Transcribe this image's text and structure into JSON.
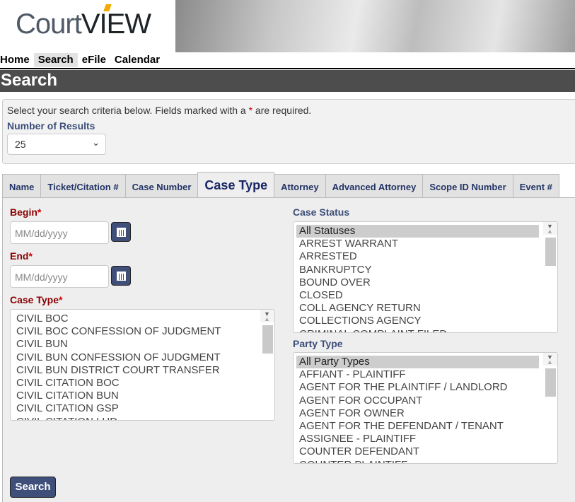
{
  "logo": {
    "text_a": "Court",
    "text_b": "VIEW"
  },
  "nav": [
    "Home",
    "Search",
    "eFile",
    "Calendar"
  ],
  "page_title": "Search",
  "criteria": {
    "instructions_a": "Select your search criteria below. Fields marked with a ",
    "asterisk": "*",
    "instructions_b": " are required.",
    "results_label": "Number of Results",
    "results_value": "25"
  },
  "tabs": [
    "Name",
    "Ticket/Citation #",
    "Case Number",
    "Case Type",
    "Attorney",
    "Advanced Attorney",
    "Scope ID Number",
    "Event #"
  ],
  "form": {
    "begin_label": "Begin",
    "end_label": "End",
    "case_type_label": "Case Type",
    "req": "*",
    "date_placeholder": "MM/dd/yyyy",
    "case_types": [
      "CIVIL BOC",
      "CIVIL BOC CONFESSION OF JUDGMENT",
      "CIVIL BUN",
      "CIVIL BUN CONFESSION OF JUDGMENT",
      "CIVIL BUN DISTRICT COURT TRANSFER",
      "CIVIL CITATION BOC",
      "CIVIL CITATION BUN",
      "CIVIL CITATION GSP",
      "CIVIL CITATION LHD"
    ],
    "case_status_label": "Case Status",
    "case_statuses": [
      "All Statuses",
      "ARREST WARRANT",
      "ARRESTED",
      "BANKRUPTCY",
      "BOUND OVER",
      "CLOSED",
      "COLL AGENCY RETURN",
      "COLLECTIONS AGENCY",
      "CRIMINAL COMPLAINT FILED"
    ],
    "party_type_label": "Party Type",
    "party_types": [
      "All Party Types",
      "AFFIANT - PLAINTIFF",
      "AGENT FOR THE PLAINTIFF / LANDLORD",
      "AGENT FOR OCCUPANT",
      "AGENT FOR OWNER",
      "AGENT FOR THE DEFENDANT / TENANT",
      "ASSIGNEE - PLAINTIFF",
      "COUNTER DEFENDANT",
      "COUNTER PLAINTIFF"
    ],
    "search_button": "Search"
  }
}
